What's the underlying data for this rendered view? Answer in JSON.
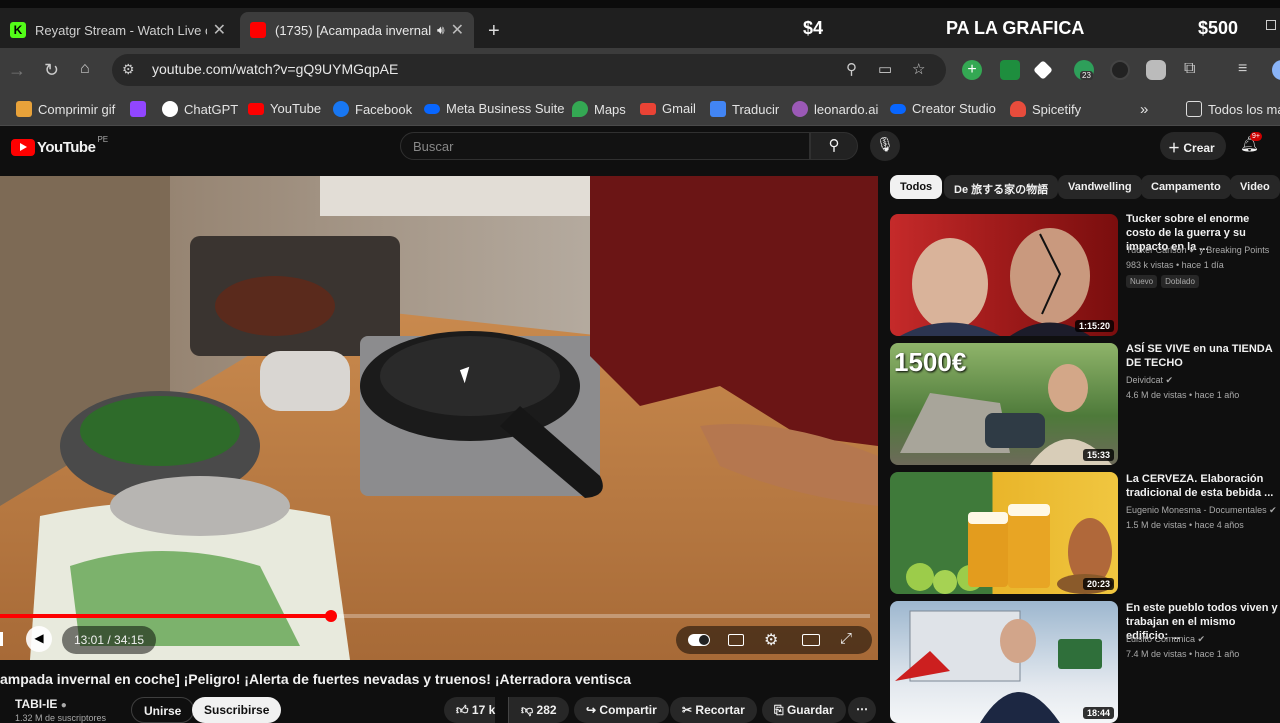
{
  "browser": {
    "tabs": [
      {
        "title": "Reyatgr Stream - Watch Live on",
        "favicon_color": "#53fc18"
      },
      {
        "title": "(1735) [Acampada invernal",
        "favicon_color": "#ff0000"
      }
    ],
    "new_tab": "+",
    "address": "youtube.com/watch?v=gQ9UYMGqpAE",
    "extension_badge": "23",
    "bookmarks": [
      {
        "label": "Comprimir gif",
        "color": "#e8a23a"
      },
      {
        "label": "",
        "color": "#9146ff"
      },
      {
        "label": "ChatGPT",
        "color": "#ffffff"
      },
      {
        "label": "YouTube",
        "color": "#ff0000"
      },
      {
        "label": "Facebook",
        "color": "#1877f2"
      },
      {
        "label": "Meta Business Suite",
        "color": "#0866ff"
      },
      {
        "label": "Maps",
        "color": "#34a853"
      },
      {
        "label": "Gmail",
        "color": "#ea4335"
      },
      {
        "label": "Traducir",
        "color": "#4285f4"
      },
      {
        "label": "leonardo.ai",
        "color": "#9b59b6"
      },
      {
        "label": "Creator Studio",
        "color": "#0866ff"
      },
      {
        "label": "Spicetify",
        "color": "#e74c3c"
      }
    ],
    "bookmarks_more": "»",
    "all_bookmarks": "Todos los ma"
  },
  "overlay": {
    "left_amount": "$4",
    "center_text": "PA LA GRAFICA",
    "right_amount": "$500"
  },
  "youtube": {
    "logo_text": "YouTube",
    "country_code": "PE",
    "search_placeholder": "Buscar",
    "create_label": "Crear",
    "notifications_badge": "9+"
  },
  "player": {
    "time": "13:01 / 34:15",
    "progress": 0.38
  },
  "video": {
    "title": "ampada invernal en coche] ¡Peligro! ¡Alerta de fuertes nevadas y truenos! ¡Aterradora ventisca",
    "channel": "TABI-IE",
    "subscribers": "1.32 M de suscriptores",
    "join": "Unirse",
    "subscribe": "Suscribirse",
    "likes": "17 k",
    "dislikes": "282",
    "share": "Compartir",
    "clip": "Recortar",
    "save": "Guardar",
    "more": "⋯"
  },
  "chips": [
    "Todos",
    "De 旅する家の物語",
    "Vandwelling",
    "Campamento",
    "Video"
  ],
  "related": [
    {
      "title": "Tucker sobre el enorme costo de la guerra y su impacto en la ...",
      "channel": "Tucker Carlson ✔ y Breaking Points",
      "meta": "983 k vistas • hace 1 día",
      "tags": [
        "Nuevo",
        "Doblado"
      ],
      "duration": "1:15:20"
    },
    {
      "title": "ASÍ SE VIVE en una TIENDA DE TECHO",
      "channel": "Deividcat ✔",
      "meta": "4.6 M de vistas • hace 1 año",
      "tags": [],
      "duration": "15:33",
      "thumb_text": "1500€"
    },
    {
      "title": "La CERVEZA. Elaboración tradicional de esta bebida ...",
      "channel": "Eugenio Monesma - Documentales ✔",
      "meta": "1.5 M de vistas • hace 4 años",
      "tags": [],
      "duration": "20:23"
    },
    {
      "title": "En este pueblo todos viven y trabajan en el mismo edificio: ...",
      "channel": "Luisito Comunica ✔",
      "meta": "7.4 M de vistas • hace 1 año",
      "tags": [],
      "duration": "18:44"
    }
  ]
}
